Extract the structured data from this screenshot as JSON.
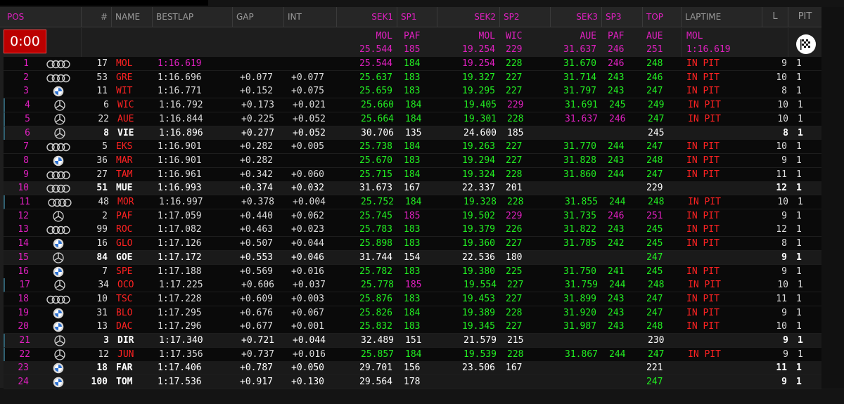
{
  "clock": "0:00",
  "headers": {
    "pos": "POS",
    "num": "#",
    "name": "NAME",
    "bestlap": "BESTLAP",
    "gap": "GAP",
    "int": "INT",
    "sek1": "SEK1",
    "sp1": "SP1",
    "sek2": "SEK2",
    "sp2": "SP2",
    "sek3": "SEK3",
    "sp3": "SP3",
    "top": "TOP",
    "laptime": "LAPTIME",
    "l": "L",
    "pit": "PIT"
  },
  "best_holders": {
    "sek1": "MOL",
    "sp1": "PAF",
    "sek2": "MOL",
    "sp2": "WIC",
    "sek3": "AUE",
    "sp3": "PAF",
    "top": "AUE",
    "laptime": "MOL"
  },
  "best_values": {
    "sek1": "25.544",
    "sp1": "185",
    "sek2": "19.254",
    "sp2": "229",
    "sek3": "31.637",
    "sp3": "246",
    "top": "251",
    "laptime": "1:16.619"
  },
  "colors": {
    "magenta": "#e020c0",
    "green": "#22ee22",
    "red": "#ff2222",
    "white": "#ffffff",
    "clock_bg": "#bb0000"
  },
  "rows": [
    {
      "pos": "1",
      "brand": "audi",
      "num": "17",
      "name": "MOL",
      "nc": "rd",
      "best": "1:16.619",
      "bc": "m",
      "gap": "",
      "int": "",
      "s1": "25.544",
      "s1c": "m",
      "sp1": "184",
      "sp1c": "g",
      "s2": "19.254",
      "s2c": "m",
      "sp2": "228",
      "sp2c": "g",
      "s3": "31.670",
      "s3c": "g",
      "sp3": "246",
      "sp3c": "m",
      "top": "248",
      "topc": "g",
      "lt": "IN PIT",
      "l": "9",
      "pit": "1",
      "hl": false
    },
    {
      "pos": "2",
      "brand": "audi",
      "num": "53",
      "name": "GRE",
      "nc": "rd",
      "best": "1:16.696",
      "bc": "y",
      "gap": "+0.077",
      "int": "+0.077",
      "s1": "25.637",
      "s1c": "g",
      "sp1": "183",
      "sp1c": "g",
      "s2": "19.327",
      "s2c": "g",
      "sp2": "227",
      "sp2c": "g",
      "s3": "31.714",
      "s3c": "g",
      "sp3": "243",
      "sp3c": "g",
      "top": "246",
      "topc": "g",
      "lt": "IN PIT",
      "l": "10",
      "pit": "1",
      "hl": false
    },
    {
      "pos": "3",
      "brand": "bmw",
      "num": "11",
      "name": "WIT",
      "nc": "rd",
      "best": "1:16.771",
      "bc": "y",
      "gap": "+0.152",
      "int": "+0.075",
      "s1": "25.659",
      "s1c": "g",
      "sp1": "183",
      "sp1c": "g",
      "s2": "19.295",
      "s2c": "g",
      "sp2": "227",
      "sp2c": "g",
      "s3": "31.797",
      "s3c": "g",
      "sp3": "243",
      "sp3c": "g",
      "top": "247",
      "topc": "g",
      "lt": "IN PIT",
      "l": "8",
      "pit": "1",
      "hl": false
    },
    {
      "pos": "4",
      "brand": "merc",
      "num": "6",
      "name": "WIC",
      "nc": "rd",
      "best": "1:16.792",
      "bc": "y",
      "gap": "+0.173",
      "int": "+0.021",
      "s1": "25.660",
      "s1c": "g",
      "sp1": "184",
      "sp1c": "g",
      "s2": "19.405",
      "s2c": "g",
      "sp2": "229",
      "sp2c": "m",
      "s3": "31.691",
      "s3c": "g",
      "sp3": "245",
      "sp3c": "g",
      "top": "249",
      "topc": "g",
      "lt": "IN PIT",
      "l": "10",
      "pit": "1",
      "hl": false
    },
    {
      "pos": "5",
      "brand": "merc",
      "num": "22",
      "name": "AUE",
      "nc": "rd",
      "best": "1:16.844",
      "bc": "y",
      "gap": "+0.225",
      "int": "+0.052",
      "s1": "25.664",
      "s1c": "g",
      "sp1": "184",
      "sp1c": "g",
      "s2": "19.301",
      "s2c": "g",
      "sp2": "228",
      "sp2c": "g",
      "s3": "31.637",
      "s3c": "m",
      "sp3": "246",
      "sp3c": "m",
      "top": "247",
      "topc": "g",
      "lt": "IN PIT",
      "l": "10",
      "pit": "1",
      "hl": false
    },
    {
      "pos": "6",
      "brand": "merc",
      "num": "8",
      "name": "VIE",
      "nc": "w",
      "best": "1:16.896",
      "bc": "w",
      "gap": "+0.277",
      "int": "+0.052",
      "s1": "30.706",
      "s1c": "w",
      "sp1": "135",
      "sp1c": "w",
      "s2": "24.600",
      "s2c": "w",
      "sp2": "185",
      "sp2c": "w",
      "s3": "",
      "s3c": "w",
      "sp3": "",
      "sp3c": "w",
      "top": "245",
      "topc": "w",
      "lt": "",
      "l": "8",
      "pit": "1",
      "hl": true
    },
    {
      "pos": "7",
      "brand": "audi",
      "num": "5",
      "name": "EKS",
      "nc": "rd",
      "best": "1:16.901",
      "bc": "y",
      "gap": "+0.282",
      "int": "+0.005",
      "s1": "25.738",
      "s1c": "g",
      "sp1": "184",
      "sp1c": "g",
      "s2": "19.263",
      "s2c": "g",
      "sp2": "227",
      "sp2c": "g",
      "s3": "31.770",
      "s3c": "g",
      "sp3": "244",
      "sp3c": "g",
      "top": "247",
      "topc": "g",
      "lt": "IN PIT",
      "l": "10",
      "pit": "1",
      "hl": false
    },
    {
      "pos": "8",
      "brand": "bmw",
      "num": "36",
      "name": "MAR",
      "nc": "rd",
      "best": "1:16.901",
      "bc": "y",
      "gap": "+0.282",
      "int": "",
      "s1": "25.670",
      "s1c": "g",
      "sp1": "183",
      "sp1c": "g",
      "s2": "19.294",
      "s2c": "g",
      "sp2": "227",
      "sp2c": "g",
      "s3": "31.828",
      "s3c": "g",
      "sp3": "243",
      "sp3c": "g",
      "top": "248",
      "topc": "g",
      "lt": "IN PIT",
      "l": "9",
      "pit": "1",
      "hl": false
    },
    {
      "pos": "9",
      "brand": "audi",
      "num": "27",
      "name": "TAM",
      "nc": "rd",
      "best": "1:16.961",
      "bc": "y",
      "gap": "+0.342",
      "int": "+0.060",
      "s1": "25.715",
      "s1c": "g",
      "sp1": "184",
      "sp1c": "g",
      "s2": "19.324",
      "s2c": "g",
      "sp2": "228",
      "sp2c": "g",
      "s3": "31.860",
      "s3c": "g",
      "sp3": "244",
      "sp3c": "g",
      "top": "247",
      "topc": "g",
      "lt": "IN PIT",
      "l": "11",
      "pit": "1",
      "hl": false
    },
    {
      "pos": "10",
      "brand": "audi",
      "num": "51",
      "name": "MUE",
      "nc": "w",
      "best": "1:16.993",
      "bc": "w",
      "gap": "+0.374",
      "int": "+0.032",
      "s1": "31.673",
      "s1c": "w",
      "sp1": "167",
      "sp1c": "w",
      "s2": "22.337",
      "s2c": "w",
      "sp2": "201",
      "sp2c": "w",
      "s3": "",
      "s3c": "w",
      "sp3": "",
      "sp3c": "w",
      "top": "229",
      "topc": "w",
      "lt": "",
      "l": "12",
      "pit": "1",
      "hl": true
    },
    {
      "pos": "11",
      "brand": "audi",
      "num": "48",
      "name": "MOR",
      "nc": "rd",
      "best": "1:16.997",
      "bc": "y",
      "gap": "+0.378",
      "int": "+0.004",
      "s1": "25.752",
      "s1c": "g",
      "sp1": "184",
      "sp1c": "g",
      "s2": "19.328",
      "s2c": "g",
      "sp2": "228",
      "sp2c": "g",
      "s3": "31.855",
      "s3c": "g",
      "sp3": "244",
      "sp3c": "g",
      "top": "248",
      "topc": "g",
      "lt": "IN PIT",
      "l": "10",
      "pit": "1",
      "hl": false
    },
    {
      "pos": "12",
      "brand": "merc",
      "num": "2",
      "name": "PAF",
      "nc": "rd",
      "best": "1:17.059",
      "bc": "y",
      "gap": "+0.440",
      "int": "+0.062",
      "s1": "25.745",
      "s1c": "g",
      "sp1": "185",
      "sp1c": "m",
      "s2": "19.502",
      "s2c": "g",
      "sp2": "229",
      "sp2c": "m",
      "s3": "31.735",
      "s3c": "g",
      "sp3": "246",
      "sp3c": "m",
      "top": "251",
      "topc": "m",
      "lt": "IN PIT",
      "l": "9",
      "pit": "1",
      "hl": false
    },
    {
      "pos": "13",
      "brand": "audi",
      "num": "99",
      "name": "ROC",
      "nc": "rd",
      "best": "1:17.082",
      "bc": "y",
      "gap": "+0.463",
      "int": "+0.023",
      "s1": "25.783",
      "s1c": "g",
      "sp1": "183",
      "sp1c": "g",
      "s2": "19.379",
      "s2c": "g",
      "sp2": "226",
      "sp2c": "g",
      "s3": "31.822",
      "s3c": "g",
      "sp3": "243",
      "sp3c": "g",
      "top": "245",
      "topc": "g",
      "lt": "IN PIT",
      "l": "12",
      "pit": "1",
      "hl": false
    },
    {
      "pos": "14",
      "brand": "bmw",
      "num": "16",
      "name": "GLO",
      "nc": "rd",
      "best": "1:17.126",
      "bc": "y",
      "gap": "+0.507",
      "int": "+0.044",
      "s1": "25.898",
      "s1c": "g",
      "sp1": "183",
      "sp1c": "g",
      "s2": "19.360",
      "s2c": "g",
      "sp2": "227",
      "sp2c": "g",
      "s3": "31.785",
      "s3c": "g",
      "sp3": "242",
      "sp3c": "g",
      "top": "245",
      "topc": "g",
      "lt": "IN PIT",
      "l": "8",
      "pit": "1",
      "hl": false
    },
    {
      "pos": "15",
      "brand": "merc",
      "num": "84",
      "name": "GOE",
      "nc": "w",
      "best": "1:17.172",
      "bc": "w",
      "gap": "+0.553",
      "int": "+0.046",
      "s1": "31.744",
      "s1c": "w",
      "sp1": "154",
      "sp1c": "w",
      "s2": "22.536",
      "s2c": "w",
      "sp2": "180",
      "sp2c": "w",
      "s3": "",
      "s3c": "w",
      "sp3": "",
      "sp3c": "w",
      "top": "247",
      "topc": "g",
      "lt": "",
      "l": "9",
      "pit": "1",
      "hl": true
    },
    {
      "pos": "16",
      "brand": "bmw",
      "num": "7",
      "name": "SPE",
      "nc": "rd",
      "best": "1:17.188",
      "bc": "y",
      "gap": "+0.569",
      "int": "+0.016",
      "s1": "25.782",
      "s1c": "g",
      "sp1": "183",
      "sp1c": "g",
      "s2": "19.380",
      "s2c": "g",
      "sp2": "225",
      "sp2c": "g",
      "s3": "31.750",
      "s3c": "g",
      "sp3": "241",
      "sp3c": "g",
      "top": "245",
      "topc": "g",
      "lt": "IN PIT",
      "l": "9",
      "pit": "1",
      "hl": false
    },
    {
      "pos": "17",
      "brand": "merc",
      "num": "34",
      "name": "OCO",
      "nc": "rd",
      "best": "1:17.225",
      "bc": "y",
      "gap": "+0.606",
      "int": "+0.037",
      "s1": "25.778",
      "s1c": "g",
      "sp1": "185",
      "sp1c": "m",
      "s2": "19.554",
      "s2c": "g",
      "sp2": "227",
      "sp2c": "g",
      "s3": "31.759",
      "s3c": "g",
      "sp3": "244",
      "sp3c": "g",
      "top": "248",
      "topc": "g",
      "lt": "IN PIT",
      "l": "10",
      "pit": "1",
      "hl": false
    },
    {
      "pos": "18",
      "brand": "audi",
      "num": "10",
      "name": "TSC",
      "nc": "rd",
      "best": "1:17.228",
      "bc": "y",
      "gap": "+0.609",
      "int": "+0.003",
      "s1": "25.876",
      "s1c": "g",
      "sp1": "183",
      "sp1c": "g",
      "s2": "19.453",
      "s2c": "g",
      "sp2": "227",
      "sp2c": "g",
      "s3": "31.899",
      "s3c": "g",
      "sp3": "243",
      "sp3c": "g",
      "top": "247",
      "topc": "g",
      "lt": "IN PIT",
      "l": "11",
      "pit": "1",
      "hl": false
    },
    {
      "pos": "19",
      "brand": "bmw",
      "num": "31",
      "name": "BLO",
      "nc": "rd",
      "best": "1:17.295",
      "bc": "y",
      "gap": "+0.676",
      "int": "+0.067",
      "s1": "25.826",
      "s1c": "g",
      "sp1": "184",
      "sp1c": "g",
      "s2": "19.389",
      "s2c": "g",
      "sp2": "228",
      "sp2c": "g",
      "s3": "31.920",
      "s3c": "g",
      "sp3": "243",
      "sp3c": "g",
      "top": "247",
      "topc": "g",
      "lt": "IN PIT",
      "l": "9",
      "pit": "1",
      "hl": false
    },
    {
      "pos": "20",
      "brand": "bmw",
      "num": "13",
      "name": "DAC",
      "nc": "rd",
      "best": "1:17.296",
      "bc": "y",
      "gap": "+0.677",
      "int": "+0.001",
      "s1": "25.832",
      "s1c": "g",
      "sp1": "183",
      "sp1c": "g",
      "s2": "19.345",
      "s2c": "g",
      "sp2": "227",
      "sp2c": "g",
      "s3": "31.987",
      "s3c": "g",
      "sp3": "243",
      "sp3c": "g",
      "top": "248",
      "topc": "g",
      "lt": "IN PIT",
      "l": "10",
      "pit": "1",
      "hl": false
    },
    {
      "pos": "21",
      "brand": "merc",
      "num": "3",
      "name": "DIR",
      "nc": "w",
      "best": "1:17.340",
      "bc": "w",
      "gap": "+0.721",
      "int": "+0.044",
      "s1": "32.489",
      "s1c": "w",
      "sp1": "151",
      "sp1c": "w",
      "s2": "21.579",
      "s2c": "w",
      "sp2": "215",
      "sp2c": "w",
      "s3": "",
      "s3c": "w",
      "sp3": "",
      "sp3c": "w",
      "top": "230",
      "topc": "w",
      "lt": "",
      "l": "9",
      "pit": "1",
      "hl": true
    },
    {
      "pos": "22",
      "brand": "merc",
      "num": "12",
      "name": "JUN",
      "nc": "rd",
      "best": "1:17.356",
      "bc": "y",
      "gap": "+0.737",
      "int": "+0.016",
      "s1": "25.857",
      "s1c": "g",
      "sp1": "184",
      "sp1c": "g",
      "s2": "19.539",
      "s2c": "g",
      "sp2": "228",
      "sp2c": "g",
      "s3": "31.867",
      "s3c": "g",
      "sp3": "244",
      "sp3c": "g",
      "top": "247",
      "topc": "g",
      "lt": "IN PIT",
      "l": "9",
      "pit": "1",
      "hl": false
    },
    {
      "pos": "23",
      "brand": "bmw",
      "num": "18",
      "name": "FAR",
      "nc": "w",
      "best": "1:17.406",
      "bc": "w",
      "gap": "+0.787",
      "int": "+0.050",
      "s1": "29.701",
      "s1c": "w",
      "sp1": "156",
      "sp1c": "w",
      "s2": "23.506",
      "s2c": "w",
      "sp2": "167",
      "sp2c": "w",
      "s3": "",
      "s3c": "w",
      "sp3": "",
      "sp3c": "w",
      "top": "221",
      "topc": "w",
      "lt": "",
      "l": "11",
      "pit": "1",
      "hl": true
    },
    {
      "pos": "24",
      "brand": "bmw",
      "num": "100",
      "name": "TOM",
      "nc": "w",
      "best": "1:17.536",
      "bc": "w",
      "gap": "+0.917",
      "int": "+0.130",
      "s1": "29.564",
      "s1c": "w",
      "sp1": "178",
      "sp1c": "w",
      "s2": "",
      "s2c": "w",
      "sp2": "",
      "sp2c": "w",
      "s3": "",
      "s3c": "w",
      "sp3": "",
      "sp3c": "w",
      "top": "247",
      "topc": "g",
      "lt": "",
      "l": "9",
      "pit": "1",
      "hl": true
    }
  ]
}
